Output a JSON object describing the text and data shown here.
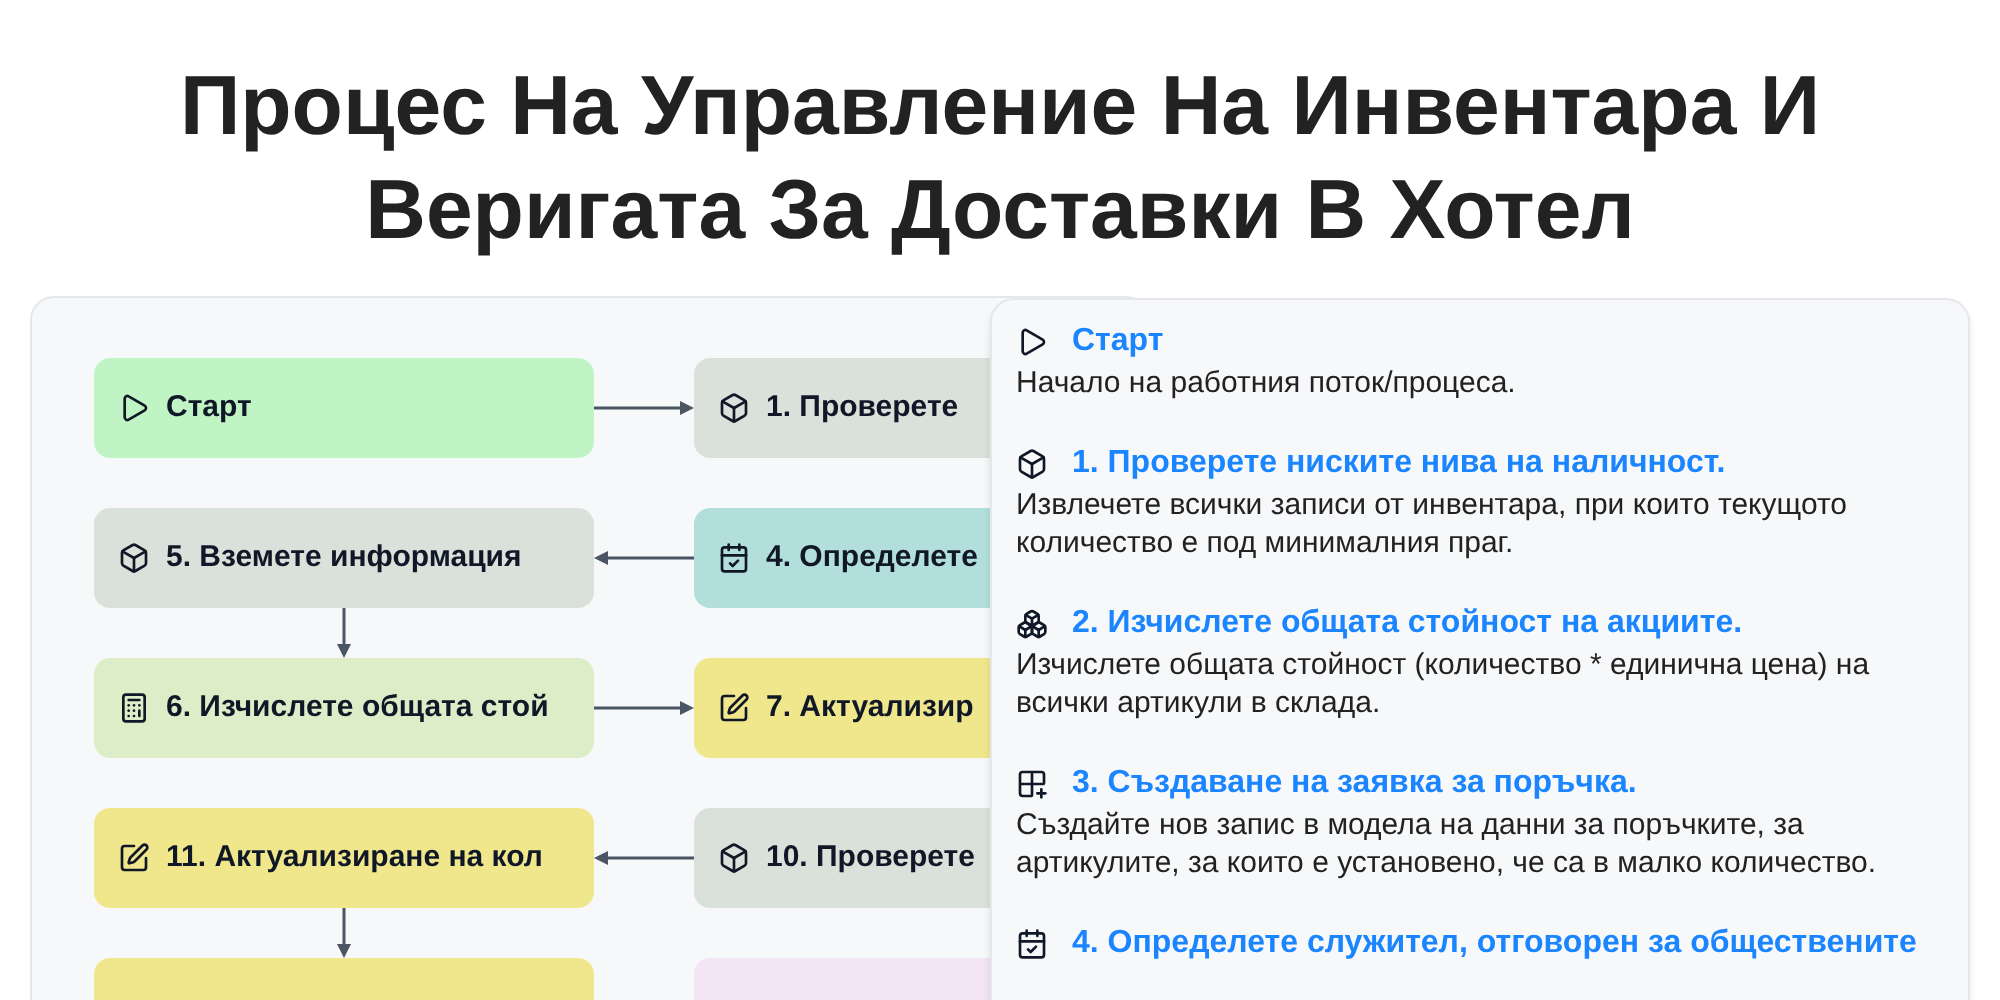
{
  "title": "Процес На Управление На Инвентара И Веригата За Доставки В Хотел",
  "rows": [
    {
      "left": {
        "label": "Старт",
        "kind": "play",
        "color": "#c1f4c5"
      },
      "right": {
        "label": "1. Проверете",
        "kind": "box",
        "color": "#dae1da"
      },
      "connector": {
        "kind": "right"
      },
      "down": false
    },
    {
      "left": {
        "label": "5. Вземете информация",
        "kind": "box",
        "color": "#dae1da"
      },
      "right": {
        "label": "4. Определете",
        "kind": "calendar",
        "color": "#b2dfdb"
      },
      "connector": {
        "kind": "left"
      },
      "down": true
    },
    {
      "left": {
        "label": "6. Изчислете общата стой",
        "kind": "calc",
        "color": "#dcedc8"
      },
      "right": {
        "label": "7. Актуализир",
        "kind": "pen",
        "color": "#f0e68c"
      },
      "connector": {
        "kind": "right"
      },
      "down": false
    },
    {
      "left": {
        "label": "11. Актуализиране на кол",
        "kind": "pen",
        "color": "#f0e68c"
      },
      "right": {
        "label": "10. Проверете",
        "kind": "box",
        "color": "#dae1da"
      },
      "connector": {
        "kind": "left"
      },
      "down": true
    },
    {
      "left": {
        "color": "#f0e68c"
      },
      "right": {
        "color": "#f3e5f5"
      }
    }
  ],
  "details": [
    {
      "kind": "play",
      "title": "Старт",
      "text": "Начало на работния поток/процеса."
    },
    {
      "kind": "box",
      "title": "1. Проверете ниските нива на наличност.",
      "text": "Извлечете всички записи от инвентара, при които текущото количество е под минималния праг."
    },
    {
      "kind": "boxes",
      "title": "2. Изчислете общата стойност на акциите.",
      "text": "Изчислете общата стойност (количество * единична цена) на всички артикули в склада."
    },
    {
      "kind": "grid",
      "title": "3. Създаване на заявка за поръчка.",
      "text": "Създайте нов запис в модела на данни за поръчките, за артикулите, за които е установено, че са в малко количество."
    },
    {
      "kind": "calendar",
      "title": "4. Определете служител, отговорен за обществените"
    }
  ]
}
